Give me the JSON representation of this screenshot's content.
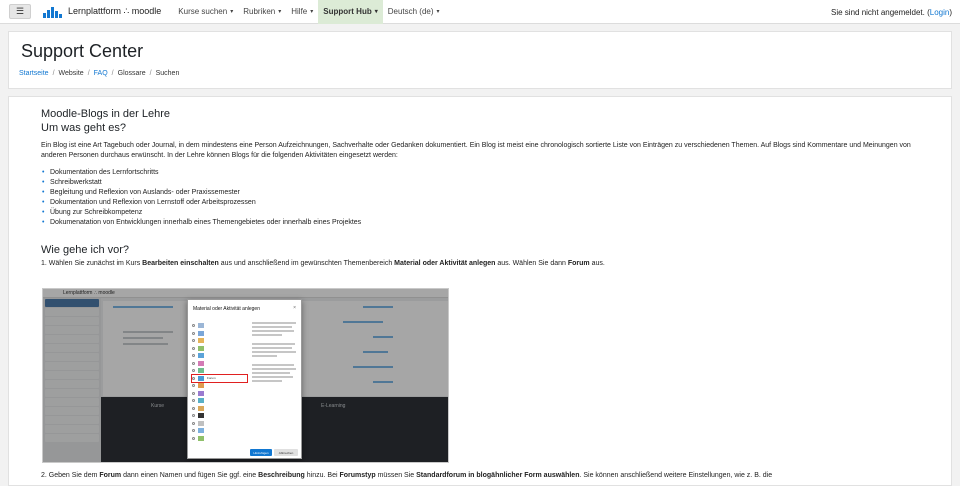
{
  "navbar": {
    "menu_icon": "hamburger-icon",
    "brand": "Lernplattform ∴ moodle",
    "items": [
      {
        "label": "Kurse suchen",
        "caret": "▾"
      },
      {
        "label": "Rubriken",
        "caret": "▾"
      },
      {
        "label": "Hilfe",
        "caret": "▾"
      },
      {
        "label": "Support Hub",
        "caret": "▾",
        "active": true
      },
      {
        "label": "Deutsch ‎(de)‎",
        "caret": "▾"
      }
    ],
    "login_text": "Sie sind nicht angemeldet. (",
    "login_link": "Login",
    "login_close": ")",
    "accent": "#1177d1",
    "active_bg": "#dcebd6"
  },
  "header": {
    "title": "Support Center",
    "breadcrumb": [
      {
        "label": "Startseite",
        "link": true
      },
      {
        "label": "Website",
        "link": false
      },
      {
        "label": "FAQ",
        "link": true
      },
      {
        "label": "Glossare",
        "link": false
      },
      {
        "label": "Suchen",
        "link": false
      }
    ],
    "separator": "/"
  },
  "article": {
    "title": "Moodle-Blogs in der Lehre",
    "subtitle": "Um was geht es?",
    "intro": "Ein Blog ist eine Art Tagebuch oder Journal, in dem mindestens eine Person Aufzeichnungen, Sachverhalte oder Gedanken dokumentiert. Ein Blog ist meist eine chronologisch sortierte Liste von Einträgen zu verschiedenen Themen. Auf Blogs sind Kommentare und Meinungen von anderen Personen durchaus erwünscht. In der Lehre können Blogs für die folgenden Aktivitäten eingesetzt werden:",
    "bullets": [
      "Dokumentation des Lernfortschritts",
      "Schreibwerkstatt",
      "Begleitung und Reflexion von Auslands- oder Praxissemester",
      "Dokumentation und Reflexion von Lernstoff oder Arbeitsprozessen",
      "Übung zur Schreibkompetenz",
      "Dokumenatation von Entwicklungen innerhalb eines Themengebietes oder innerhalb eines Projektes"
    ],
    "how_heading": "Wie gehe ich vor?",
    "step1": {
      "p1": "1. Wählen Sie zunächst im Kurs ",
      "b1": "Bearbeiten einschalten",
      "p2": " aus und anschließend im gewünschten Themenbereich ",
      "b2": "Material oder Aktivität anlegen",
      "p3": " aus. Wählen Sie dann ",
      "b3": "Forum",
      "p4": " aus."
    },
    "screenshot": {
      "brand": "Lernplattform ∴ moodle",
      "modal_title": "Material oder Aktivität anlegen",
      "close_icon": "close-icon",
      "highlighted_item": "Forum",
      "footer_col1": "Kurse",
      "footer_col2": "E-Learning",
      "add_button": "Hinzufügen",
      "cancel_button": "Abbrechen",
      "highlight_color": "#e02020"
    },
    "step2": {
      "p1": "2. Geben Sie dem ",
      "b1": "Forum",
      "p2": " dann einen Namen und fügen Sie ggf. eine ",
      "b2": "Beschreibung",
      "p3": " hinzu. Bei ",
      "b3": "Forumstyp",
      "p4": " müssen Sie ",
      "b4": "Standardforum in blogähnlicher Form auswählen",
      "p5": ". Sie können anschließend weitere Einstellungen, wie z. B. die"
    }
  }
}
